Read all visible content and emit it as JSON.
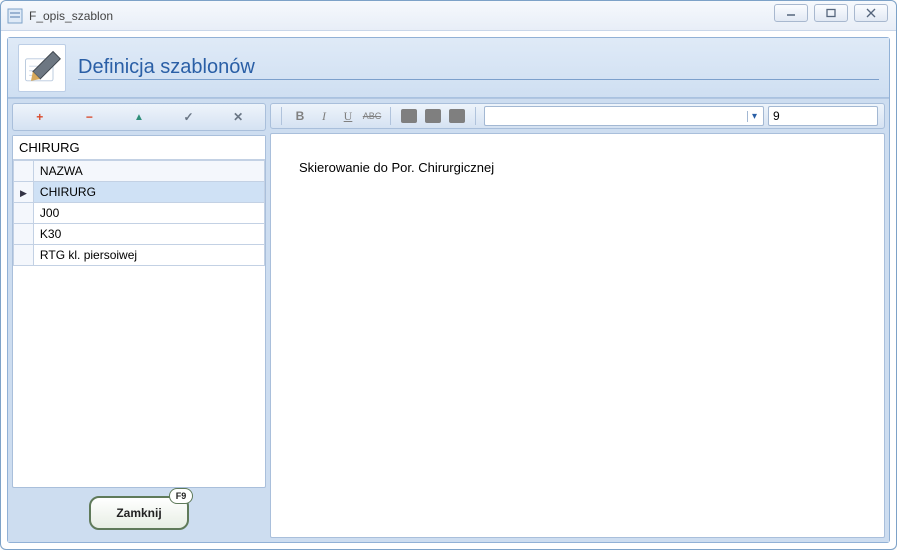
{
  "window": {
    "title": "F_opis_szablon"
  },
  "header": {
    "title": "Definicja szablonów"
  },
  "list_toolbar": {
    "add": "+",
    "remove": "−",
    "up": "▲",
    "confirm": "✓",
    "cancel": "✕"
  },
  "filter_value": "CHIRURG",
  "grid": {
    "column_header": "NAZWA",
    "selected_index": 0,
    "rows": [
      {
        "nazwa": "CHIRURG"
      },
      {
        "nazwa": "J00"
      },
      {
        "nazwa": "K30"
      },
      {
        "nazwa": "RTG kl. piersoiwej"
      }
    ]
  },
  "close_button": {
    "label": "Zamknij",
    "shortcut": "F9"
  },
  "editor_toolbar": {
    "bold": "B",
    "italic": "I",
    "underline": "U",
    "strike": "ABC",
    "font_name": "",
    "font_size": "9"
  },
  "editor_content": "Skierowanie do Por. Chirurgicznej"
}
